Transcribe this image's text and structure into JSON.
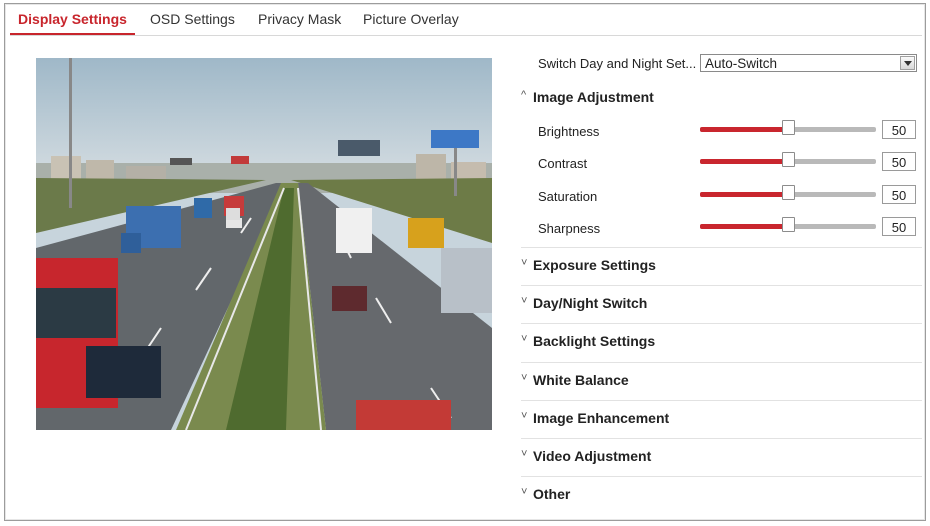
{
  "tabs": [
    "Display Settings",
    "OSD Settings",
    "Privacy Mask",
    "Picture Overlay"
  ],
  "switch_day_night": {
    "label": "Switch Day and Night Set...",
    "value": "Auto-Switch"
  },
  "image_adjustment": {
    "title": "Image Adjustment",
    "expanded_icon": "^",
    "sliders": [
      {
        "label": "Brightness",
        "value": "50",
        "level": 0.5
      },
      {
        "label": "Contrast",
        "value": "50",
        "level": 0.5
      },
      {
        "label": "Saturation",
        "value": "50",
        "level": 0.5
      },
      {
        "label": "Sharpness",
        "value": "50",
        "level": 0.5
      }
    ]
  },
  "sections": [
    "Exposure Settings",
    "Day/Night Switch",
    "Backlight Settings",
    "White Balance",
    "Image Enhancement",
    "Video Adjustment",
    "Other"
  ],
  "collapsed_icon": "˅",
  "colors": {
    "accent": "#c8252c",
    "slider_fill": "#c9262e",
    "slider_track": "#b9b9b9"
  }
}
